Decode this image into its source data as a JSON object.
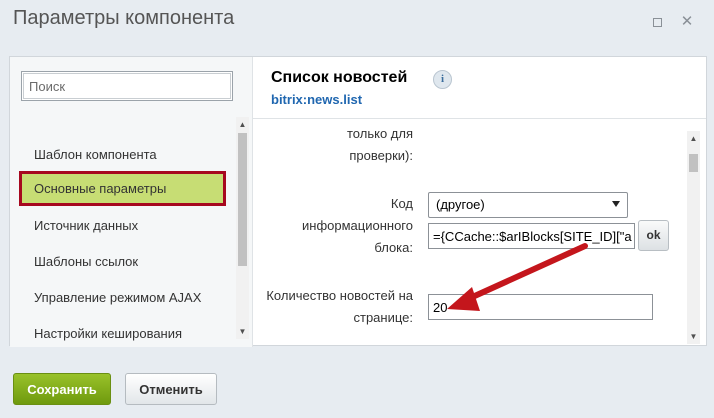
{
  "window": {
    "title": "Параметры компонента",
    "maximize_icon": "maximize-icon",
    "close_icon": "close-icon"
  },
  "sidebar": {
    "search_placeholder": "Поиск",
    "items": [
      {
        "label": "Шаблон компонента",
        "active": false
      },
      {
        "label": "Основные параметры",
        "active": true
      },
      {
        "label": "Источник данных",
        "active": false
      },
      {
        "label": "Шаблоны ссылок",
        "active": false
      },
      {
        "label": "Управление режимом AJAX",
        "active": false
      },
      {
        "label": "Настройки кеширования",
        "active": false
      }
    ],
    "highlight_color": "#a6081f",
    "active_bg": "#c7dd74"
  },
  "component": {
    "title": "Список новостей",
    "code": "bitrix:news.list",
    "info_icon": "info-icon"
  },
  "properties": {
    "partial_label": "только для проверки):",
    "iblock_label": "Код информационного блока:",
    "iblock_select": "(другое)",
    "iblock_value": "={CCache::$arIBlocks[SITE_ID][\"a",
    "ok_label": "ok",
    "news_count_label": "Количество новостей на странице:",
    "news_count_value": "20"
  },
  "annotation": {
    "arrow_color": "#c4161c"
  },
  "footer": {
    "save_label": "Сохранить",
    "cancel_label": "Отменить"
  }
}
